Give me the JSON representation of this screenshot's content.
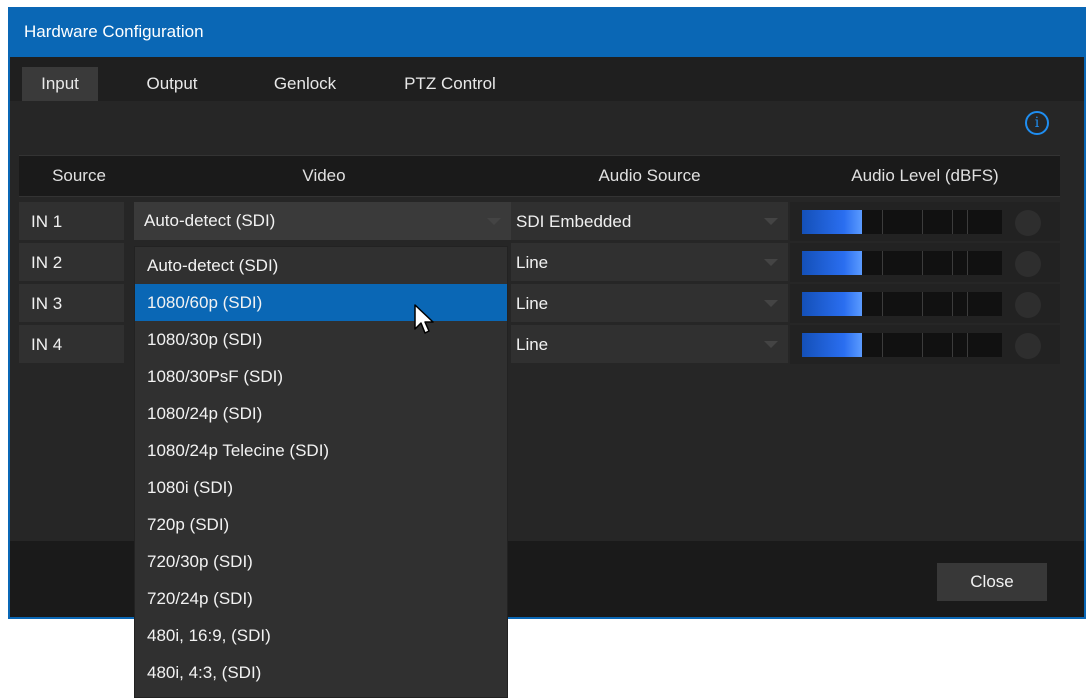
{
  "window": {
    "title": "Hardware Configuration"
  },
  "tabs": [
    {
      "label": "Input",
      "active": true
    },
    {
      "label": "Output",
      "active": false
    },
    {
      "label": "Genlock",
      "active": false
    },
    {
      "label": "PTZ Control",
      "active": false
    }
  ],
  "info_icon": "i",
  "table": {
    "headers": {
      "source": "Source",
      "video": "Video",
      "audio_source": "Audio Source",
      "audio_level": "Audio Level (dBFS)"
    },
    "rows": [
      {
        "source": "IN 1",
        "video": "Auto-detect (SDI)",
        "audio_source": "SDI Embedded",
        "level": 0.3
      },
      {
        "source": "IN 2",
        "video": "",
        "audio_source": "Line",
        "level": 0.3
      },
      {
        "source": "IN 3",
        "video": "",
        "audio_source": "Line",
        "level": 0.3
      },
      {
        "source": "IN 4",
        "video": "",
        "audio_source": "Line",
        "level": 0.3
      }
    ]
  },
  "video_dropdown": {
    "selected_index": 1,
    "options": [
      "Auto-detect (SDI)",
      "1080/60p (SDI)",
      "1080/30p (SDI)",
      "1080/30PsF (SDI)",
      "1080/24p (SDI)",
      "1080/24p Telecine (SDI)",
      "1080i (SDI)",
      "720p (SDI)",
      "720/30p (SDI)",
      "720/24p (SDI)",
      "480i, 16:9, (SDI)",
      "480i, 4:3, (SDI)"
    ]
  },
  "footer": {
    "close_label": "Close"
  },
  "colors": {
    "accent": "#0a67b5",
    "info": "#1f8ef1",
    "meter": "#2a6ef0"
  }
}
